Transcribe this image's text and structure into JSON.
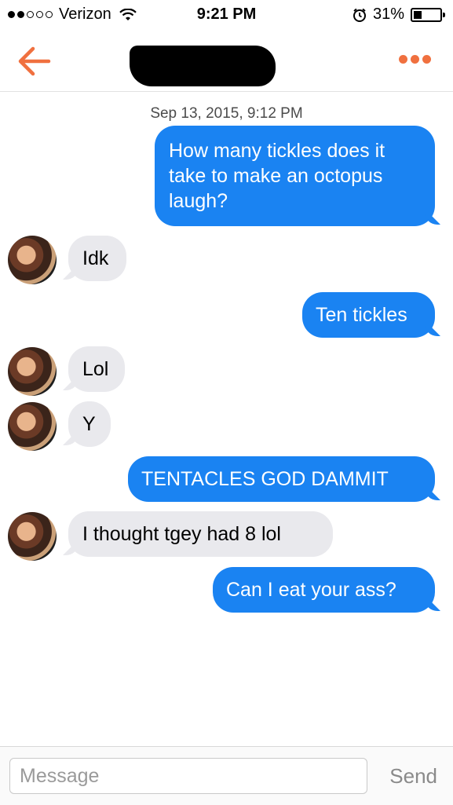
{
  "status_bar": {
    "carrier": "Verizon",
    "time": "9:21 PM",
    "battery": "31%",
    "signal_icon": "signal-dots-icon",
    "wifi_icon": "wifi-icon",
    "alarm_icon": "alarm-icon",
    "battery_icon": "battery-icon"
  },
  "header": {
    "back_icon": "back-arrow-icon",
    "contact_name": "",
    "more_icon": "more-dots-icon",
    "accent_color": "#f0703f"
  },
  "conversation": {
    "timestamp": "Sep 13, 2015, 9:12 PM",
    "messages": [
      {
        "from": "me",
        "text": "How many tickles does it take to make an octopus laugh?"
      },
      {
        "from": "them",
        "text": "Idk"
      },
      {
        "from": "me",
        "text": "Ten tickles"
      },
      {
        "from": "them",
        "text": "Lol"
      },
      {
        "from": "them",
        "text": "Y"
      },
      {
        "from": "me",
        "text": "TENTACLES GOD DAMMIT"
      },
      {
        "from": "them",
        "text": "I thought tgey had 8 lol"
      },
      {
        "from": "me",
        "text": "Can I eat your ass?"
      }
    ],
    "outgoing_color": "#1a83f2",
    "incoming_color": "#e9e9ed"
  },
  "input_bar": {
    "placeholder": "Message",
    "value": "",
    "send_label": "Send"
  }
}
